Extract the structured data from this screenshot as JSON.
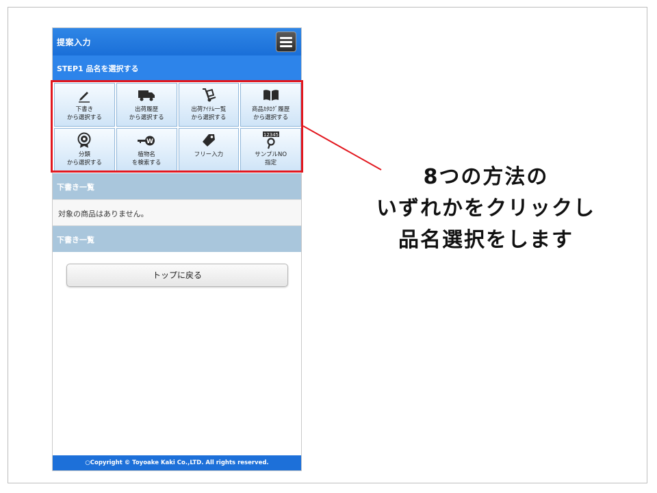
{
  "header": {
    "title": "提案入力",
    "menu_icon": "hamburger-menu-icon"
  },
  "step": {
    "label": "STEP1 品名を選択する"
  },
  "methods": [
    {
      "icon": "pencil-icon",
      "line1": "下書き",
      "line2": "から選択する"
    },
    {
      "icon": "truck-icon",
      "line1": "出荷履歴",
      "line2": "から選択する"
    },
    {
      "icon": "hand-truck-icon",
      "line1": "出荷ｱｲﾃﾑ一覧",
      "line2": "から選択する"
    },
    {
      "icon": "open-book-icon",
      "line1": "商品ｶﾀﾛｸﾞ履歴",
      "line2": "から選択する"
    },
    {
      "icon": "flower-badge-icon",
      "line1": "分類",
      "line2": "から選択する"
    },
    {
      "icon": "key-icon",
      "line1": "植物名",
      "line2": "を検索する"
    },
    {
      "icon": "tag-icon",
      "line1": "フリー入力",
      "line2": ""
    },
    {
      "icon": "numbered-search-icon",
      "icon_text": "12345",
      "line1": "サンプルNO",
      "line2": "指定"
    }
  ],
  "drafts_section": {
    "title": "下書き一覧",
    "empty_message": "対象の商品はありません。"
  },
  "drafts_section_2": {
    "title": "下書き一覧"
  },
  "back_button": {
    "label": "トップに戻る"
  },
  "footer": {
    "text": "○Copyright © Toyoake Kaki Co.,LTD. All rights reserved."
  },
  "annotation": {
    "line1": "8つの方法の",
    "line2": "いずれかをクリックし",
    "line3": "品名選択をします",
    "color": "#e2171e"
  },
  "colors": {
    "header_blue": "#1a6fd8",
    "step_blue": "#2d84ea",
    "section_blue_gray": "#a9c6dc",
    "tile_border": "#8fb6d9",
    "highlight_red": "#e2171e"
  }
}
